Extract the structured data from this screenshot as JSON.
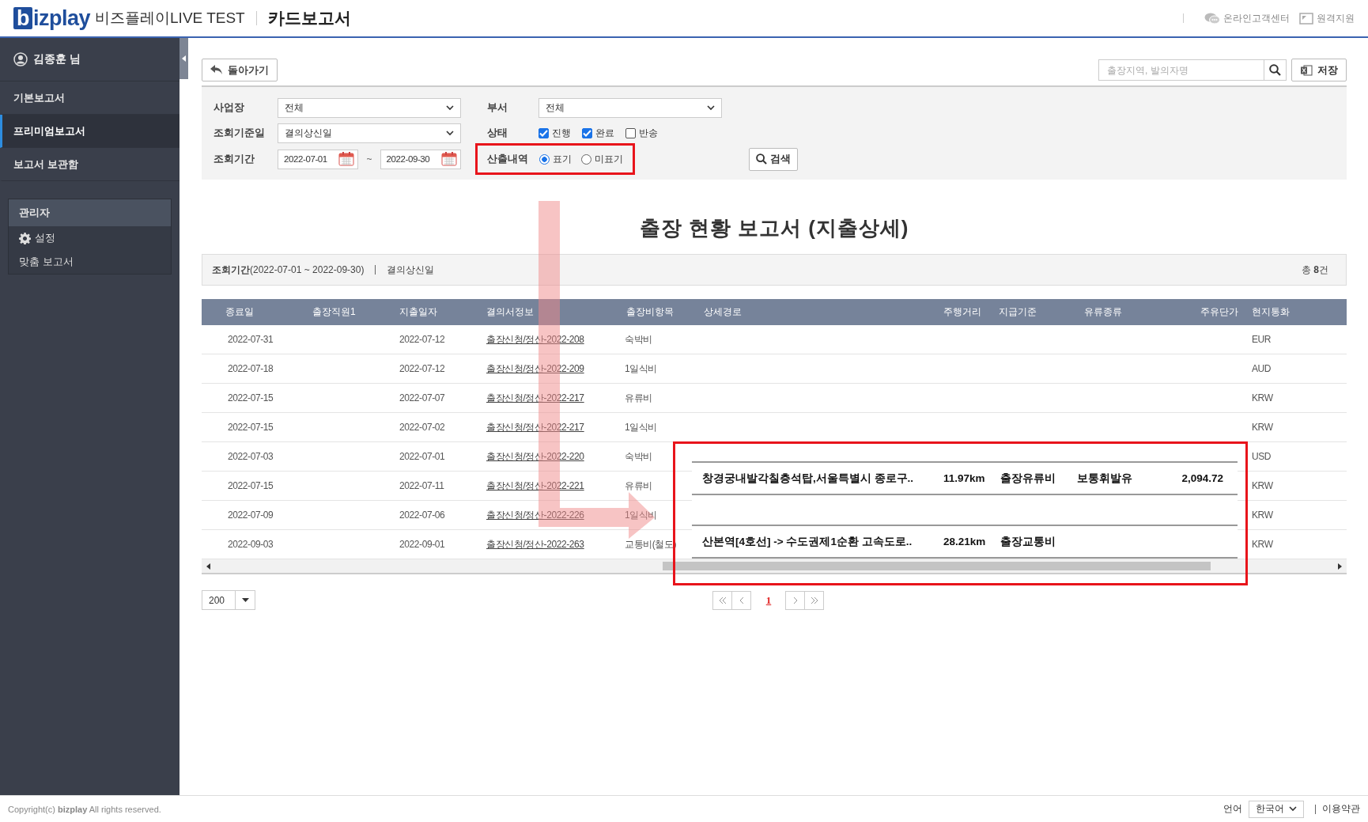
{
  "header": {
    "logo": "bizplay",
    "service": "비즈플레이LIVE TEST",
    "page_title": "카드보고서",
    "links": [
      {
        "label": "온라인고객센터",
        "kind": "chat"
      },
      {
        "label": "원격지원",
        "kind": "remote"
      }
    ]
  },
  "sidebar": {
    "user": "김종훈 님",
    "items": [
      {
        "label": "기본보고서",
        "selected": false
      },
      {
        "label": "프리미엄보고서",
        "selected": true
      },
      {
        "label": "보고서 보관함",
        "selected": false
      }
    ],
    "admin": {
      "title": "관리자",
      "items": [
        {
          "label": "설정",
          "kind": "settings"
        },
        {
          "label": "맞춤 보고서",
          "kind": "plain"
        }
      ]
    }
  },
  "toolbar": {
    "back": "돌아가기",
    "search": {
      "placeholder": "출장지역, 발의자명"
    },
    "save": "저장"
  },
  "filters": {
    "site": {
      "label": "사업장",
      "value": "전체"
    },
    "dept": {
      "label": "부서",
      "value": "전체"
    },
    "base_date": {
      "label": "조회기준일",
      "value": "결의상신일"
    },
    "status": {
      "label": "상태",
      "options": [
        {
          "label": "진행",
          "checked": true
        },
        {
          "label": "완료",
          "checked": true
        },
        {
          "label": "반송",
          "checked": false
        }
      ]
    },
    "period": {
      "label": "조회기간",
      "from": "2022-07-01",
      "separator": "~",
      "to": "2022-09-30"
    },
    "calc": {
      "label": "산출내역",
      "options": [
        {
          "label": "표기",
          "selected": true
        },
        {
          "label": "미표기",
          "selected": false
        }
      ]
    },
    "search_button": "검색"
  },
  "report": {
    "title": "출장 현황 보고서 (지출상세)",
    "period": "**조회기간**(2022-07-01 ~ 2022-09-30)",
    "basis": "결의상신일",
    "total": "총 **8**건"
  },
  "table": {
    "columns": [
      "종료일",
      "출장직원1",
      "지출일자",
      "결의서정보",
      "출장비항목",
      "상세경로",
      "주행거리",
      "지급기준",
      "유류종류",
      "주유단가",
      "현지통화"
    ],
    "rows": [
      {
        "end_date": "2022-07-31",
        "spend_date": "2022-07-12",
        "document": "출장신청/정산-2022-208",
        "item": "숙박비",
        "currency": "EUR"
      },
      {
        "end_date": "2022-07-18",
        "spend_date": "2022-07-12",
        "document": "출장신청/정산-2022-209",
        "item": "1일식비",
        "currency": "AUD"
      },
      {
        "end_date": "2022-07-15",
        "spend_date": "2022-07-07",
        "document": "출장신청/정산-2022-217",
        "item": "유류비",
        "currency": "KRW"
      },
      {
        "end_date": "2022-07-15",
        "spend_date": "2022-07-02",
        "document": "출장신청/정산-2022-217",
        "item": "1일식비",
        "currency": "KRW"
      },
      {
        "end_date": "2022-07-03",
        "spend_date": "2022-07-01",
        "document": "출장신청/정산-2022-220",
        "item": "숙박비",
        "currency": "USD"
      },
      {
        "end_date": "2022-07-15",
        "spend_date": "2022-07-11",
        "document": "출장신청/정산-2022-221",
        "item": "유류비",
        "currency": "KRW"
      },
      {
        "end_date": "2022-07-09",
        "spend_date": "2022-07-06",
        "document": "출장신청/정산-2022-226",
        "item": "1일식비",
        "currency": "KRW"
      },
      {
        "end_date": "2022-09-03",
        "spend_date": "2022-09-01",
        "document": "출장신청/정산-2022-263",
        "item": "교통비(철도)",
        "currency": "KRW"
      }
    ]
  },
  "pagination": {
    "page_size": "200",
    "pages": [
      {
        "label": "1",
        "selected": true
      }
    ]
  },
  "callout": {
    "rows": [
      {
        "kind": "detail",
        "route": "창경궁내발각칠층석탑,서울특별시 종로구..",
        "distance": "11.97km",
        "basis": "출장유류비",
        "fuel_type": "보통휘발유",
        "unit_price": "2,094.72"
      },
      {
        "kind": "blank"
      },
      {
        "kind": "detail",
        "route": "산본역[4호선] -> 수도권제1순환 고속도로..",
        "distance": "28.21km",
        "basis": "출장교통비"
      }
    ]
  },
  "footer": {
    "copyright": "Copyright(c) **bizplay** All rights reserved.",
    "language_label": "언어",
    "language": "한국어",
    "terms": "이용약관"
  }
}
